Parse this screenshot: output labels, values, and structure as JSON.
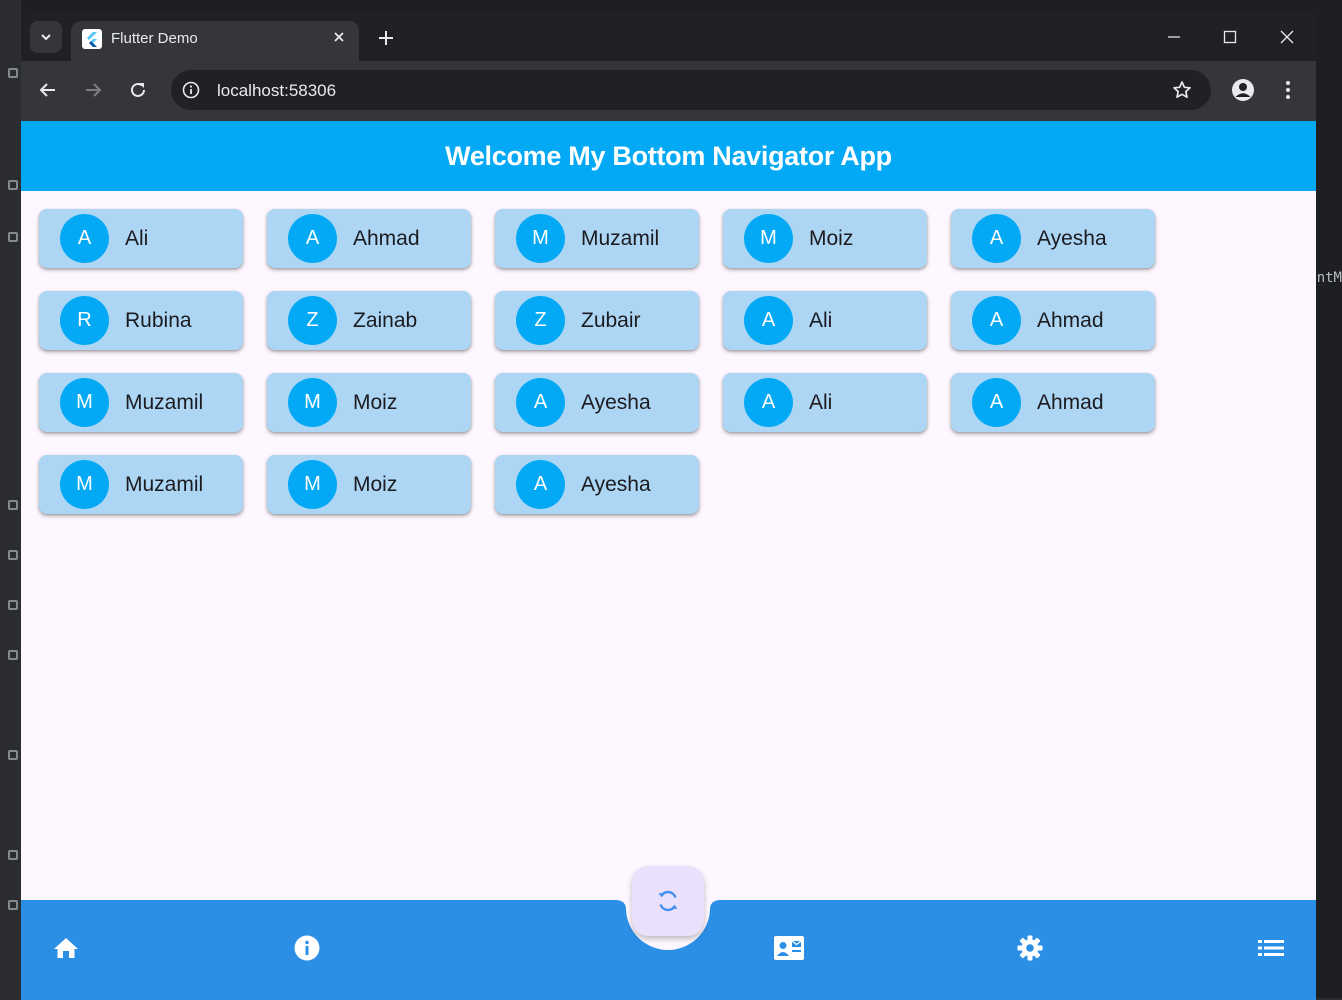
{
  "browser": {
    "tab_title": "Flutter Demo",
    "url": "localhost:58306"
  },
  "background": {
    "editor_fragment": "ntM"
  },
  "app": {
    "title": "Welcome My Bottom Navigator App",
    "cards": [
      {
        "initial": "A",
        "name": "Ali"
      },
      {
        "initial": "A",
        "name": "Ahmad"
      },
      {
        "initial": "M",
        "name": "Muzamil"
      },
      {
        "initial": "M",
        "name": "Moiz"
      },
      {
        "initial": "A",
        "name": "Ayesha"
      },
      {
        "initial": "R",
        "name": "Rubina"
      },
      {
        "initial": "Z",
        "name": "Zainab"
      },
      {
        "initial": "Z",
        "name": "Zubair"
      },
      {
        "initial": "A",
        "name": "Ali"
      },
      {
        "initial": "A",
        "name": "Ahmad"
      },
      {
        "initial": "M",
        "name": "Muzamil"
      },
      {
        "initial": "M",
        "name": "Moiz"
      },
      {
        "initial": "A",
        "name": "Ayesha"
      },
      {
        "initial": "A",
        "name": "Ali"
      },
      {
        "initial": "A",
        "name": "Ahmad"
      },
      {
        "initial": "M",
        "name": "Muzamil"
      },
      {
        "initial": "M",
        "name": "Moiz"
      },
      {
        "initial": "A",
        "name": "Ayesha"
      }
    ],
    "bottom_nav": {
      "items": [
        "home-icon",
        "info-icon",
        "contact-mail-icon",
        "settings-icon",
        "list-icon"
      ],
      "fab_icon": "sync-icon"
    }
  },
  "colors": {
    "app_bar": "#03a9f4",
    "avatar": "#03a9f4",
    "card": "#acd6f4",
    "bottom_nav": "#2b8fe6",
    "fab": "#ebe0fb",
    "page_background": "#fef7ff"
  }
}
